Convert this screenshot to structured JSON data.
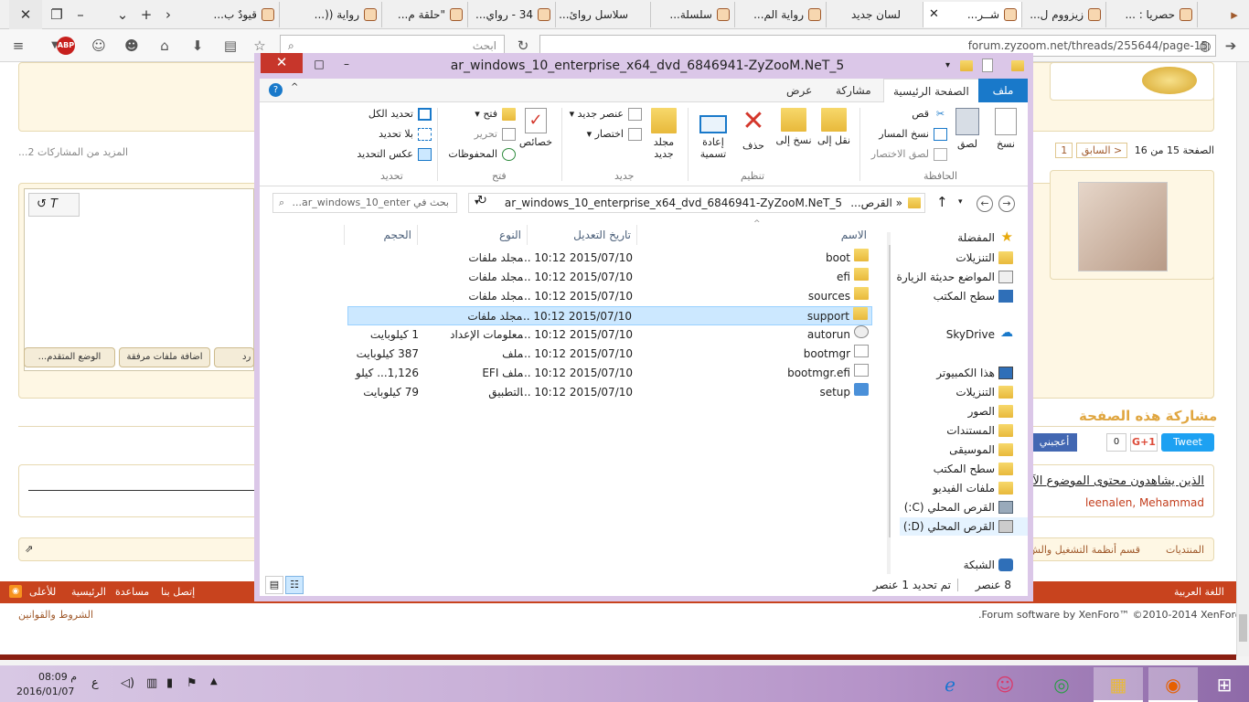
{
  "browser": {
    "tabs": [
      {
        "label": "قيودٌ ب..."
      },
      {
        "label": "رواية ((..."
      },
      {
        "label": "\"حلقة م..."
      },
      {
        "label": "34 - رواي..."
      },
      {
        "label": "سلاسل روائ..."
      },
      {
        "label": "سلسلة..."
      },
      {
        "label": "رواية الم..."
      },
      {
        "label": "زيزووم ل..."
      },
      {
        "label": "شــر..."
      },
      {
        "label": "لسان جديد"
      },
      {
        "label": "حصريا : ..."
      }
    ],
    "url": "forum.zyzoom.net/threads/255644/page-15",
    "search_placeholder": "ابحث",
    "abp_label": "ABP"
  },
  "forum": {
    "more_posts": "المزيد من المشاركات 2...",
    "pagination": {
      "page_text": "الصفحة 15 من 16",
      "prev": "< السابق",
      "first": "1"
    },
    "buttons": {
      "advanced": "الوضع المتقدم...",
      "attach": "اضافة ملفات مرفقة",
      "reply": "رد"
    },
    "share_title": "مشاركة هذه الصفحة",
    "share": {
      "tweet": "Tweet",
      "gplus": "G+1",
      "like": "أعجبني",
      "count": "0"
    },
    "viewers_title": "الذين يشاهدون محتوى الموضوع الآن",
    "viewers_names": "leenalen, Mehammad",
    "breadcrumb": {
      "forums": "المنتديات",
      "section": "قسم أنظمة التشغيل والش"
    },
    "footer_links": {
      "contact": "إتصل بنا",
      "help": "مساعدة",
      "home": "الرئيسية",
      "top": "للأعلى",
      "language": "اللغة العربية"
    },
    "terms": "الشروط والقوانين",
    "copyright": "Forum software by XenForo™ ©2010-2014 XenForo Ltd."
  },
  "explorer": {
    "title": "ar_windows_10_enterprise_x64_dvd_6846941-ZyZooM.NeT_5",
    "ribbon_tabs": {
      "file": "ملف",
      "home": "الصفحة الرئيسية",
      "share": "مشاركة",
      "view": "عرض"
    },
    "ribbon": {
      "copy": "نسخ",
      "paste": "لصق",
      "cut": "قص",
      "copy_path": "نسخ المسار",
      "paste_shortcut": "لصق الاختصار",
      "move_to": "نقل إلى",
      "copy_to": "نسخ إلى",
      "delete": "حذف",
      "rename": "إعادة تسمية",
      "new_folder": "مجلد جديد",
      "new_item": "عنصر جديد",
      "easy_access": "اختصار",
      "properties": "خصائص",
      "open": "فتح",
      "edit": "تحرير",
      "history": "المحفوظات",
      "select_all": "تحديد الكل",
      "select_none": "بلا تحديد",
      "invert": "عكس التحديد",
      "groups": {
        "clipboard": "الحافظة",
        "organize": "تنظيم",
        "new": "جديد",
        "open": "فتح",
        "select": "تحديد"
      }
    },
    "address": "ar_windows_10_enterprise_x64_dvd_6846941-ZyZooM.NeT_5",
    "address_prefix": "« القرص...",
    "search_placeholder": "بحث في ar_windows_10_enter...",
    "nav": {
      "favorites": "المفضلة",
      "downloads": "التنزيلات",
      "recent": "المواضع حديثة الزيارة",
      "desktop": "سطح المكتب",
      "skydrive": "SkyDrive",
      "computer": "هذا الكمبيوتر",
      "downloads2": "التنزيلات",
      "pictures": "الصور",
      "documents": "المستندات",
      "music": "الموسيقى",
      "desktop2": "سطح المكتب",
      "videos": "ملفات الفيديو",
      "drive_c": "القرص المحلي (C:)",
      "drive_d": "القرص المحلي (D:)",
      "network": "الشبكة"
    },
    "columns": {
      "name": "الاسم",
      "date": "تاريخ التعديل",
      "type": "النوع",
      "size": "الحجم"
    },
    "files": [
      {
        "name": "boot",
        "date": "2015/07/10 10:12 ...",
        "type": "مجلد ملفات",
        "size": "",
        "kind": "folder"
      },
      {
        "name": "efi",
        "date": "2015/07/10 10:12 ...",
        "type": "مجلد ملفات",
        "size": "",
        "kind": "folder"
      },
      {
        "name": "sources",
        "date": "2015/07/10 10:12 ...",
        "type": "مجلد ملفات",
        "size": "",
        "kind": "folder"
      },
      {
        "name": "support",
        "date": "2015/07/10 10:12 ...",
        "type": "مجلد ملفات",
        "size": "",
        "kind": "folder"
      },
      {
        "name": "autorun",
        "date": "2015/07/10 10:12 ...",
        "type": "معلومات الإعداد",
        "size": "1 كيلوبايت",
        "kind": "inf"
      },
      {
        "name": "bootmgr",
        "date": "2015/07/10 10:12 ...",
        "type": "ملف",
        "size": "387 كيلوبايت",
        "kind": "file"
      },
      {
        "name": "bootmgr.efi",
        "date": "2015/07/10 10:12 ...",
        "type": "ملف EFI",
        "size": "1,126... كيلو",
        "kind": "file"
      },
      {
        "name": "setup",
        "date": "2015/07/10 10:12 ...",
        "type": "التطبيق",
        "size": "79 كيلوبايت",
        "kind": "app"
      }
    ],
    "status": {
      "count": "8 عنصر",
      "selected": "تم تحديد 1 عنصر"
    }
  },
  "taskbar": {
    "time": "08:09 م",
    "date": "2016/01/07",
    "lang": "ع"
  }
}
